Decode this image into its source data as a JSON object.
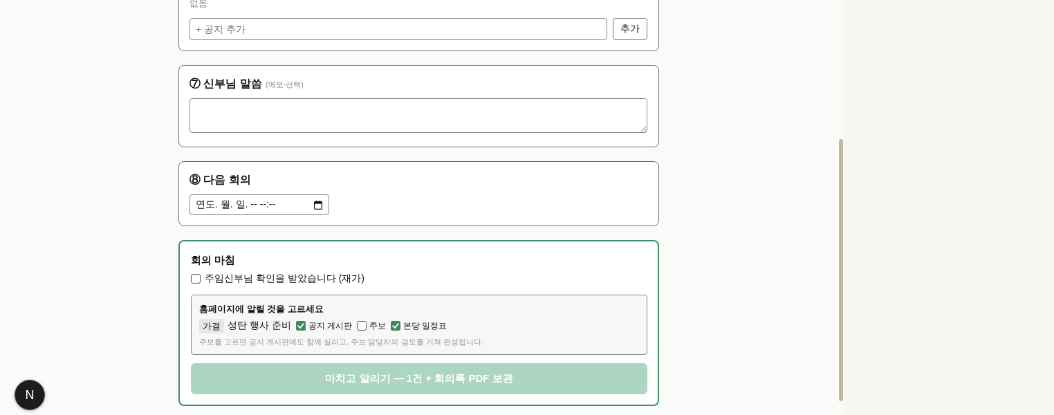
{
  "notices": {
    "empty_text": "없음",
    "input": {
      "placeholder": "+ 공지 추가"
    },
    "add_button": "추가"
  },
  "sections": [
    {
      "kind": "textarea",
      "title": "⑦ 신부님 말씀",
      "hint": "(메모·선택)"
    },
    {
      "kind": "datetime",
      "title": "⑧ 다음 회의",
      "field": {
        "placeholder": "연도. 월. 일. -- --:--"
      }
    }
  ],
  "closing": {
    "title": "회의 마침",
    "approval": {
      "label": "주임신부님 확인을 받았습니다 (재가)",
      "checked": false
    },
    "publish": {
      "title": "홈페이지에 알릴 것을 고르세요",
      "items": [
        {
          "status": "가결",
          "title": "성탄 행사 준비",
          "channels": [
            {
              "label": "공지 게시판",
              "checked": true
            },
            {
              "label": "주보",
              "checked": false
            },
            {
              "label": "본당 일정표",
              "checked": true
            }
          ]
        }
      ],
      "note": "주보를 고르면 공지 게시판에도 함께 실리고, 주보 담당자의 검토를 거쳐 편성됩니다."
    },
    "finish_button": {
      "label": "마치고 알리기 — 1건 + 회의록 PDF 보관",
      "disabled": true
    }
  },
  "dev_indicator": {
    "label": "N"
  }
}
